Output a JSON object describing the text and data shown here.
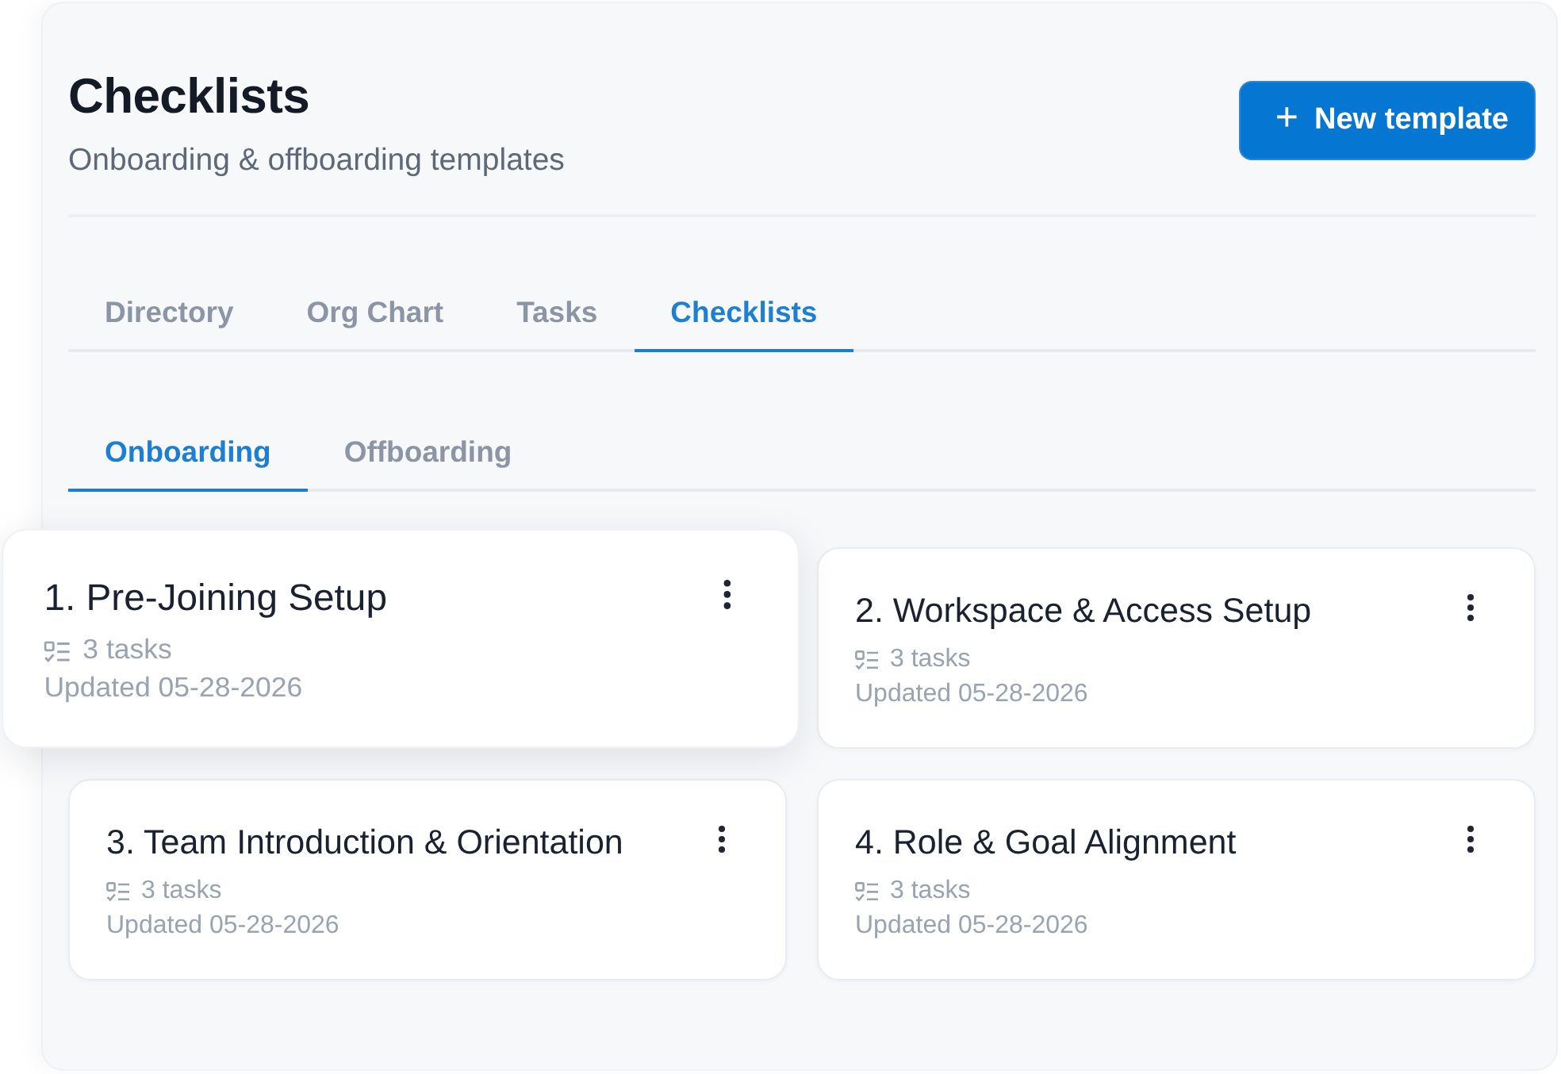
{
  "header": {
    "title": "Checklists",
    "subtitle": "Onboarding & offboarding templates",
    "new_button": {
      "icon": "+",
      "label": "New template"
    }
  },
  "tabs": [
    {
      "label": "Directory",
      "selected": false
    },
    {
      "label": "Org Chart",
      "selected": false
    },
    {
      "label": "Tasks",
      "selected": false
    },
    {
      "label": "Checklists",
      "selected": true
    }
  ],
  "sub_tabs": [
    {
      "label": "Onboarding",
      "selected": true
    },
    {
      "label": "Offboarding",
      "selected": false
    }
  ],
  "templates": [
    {
      "title": "1. Pre-Joining Setup",
      "tasks": "3 tasks",
      "updated": "Updated 05-28-2026",
      "lifted": true
    },
    {
      "title": "2. Workspace & Access Setup",
      "tasks": "3 tasks",
      "updated": "Updated 05-28-2026",
      "lifted": false
    },
    {
      "title": "3. Team Introduction & Orientation",
      "tasks": "3 tasks",
      "updated": "Updated 05-28-2026",
      "lifted": false
    },
    {
      "title": "4. Role & Goal Alignment",
      "tasks": "3 tasks",
      "updated": "Updated 05-28-2026",
      "lifted": false
    }
  ]
}
